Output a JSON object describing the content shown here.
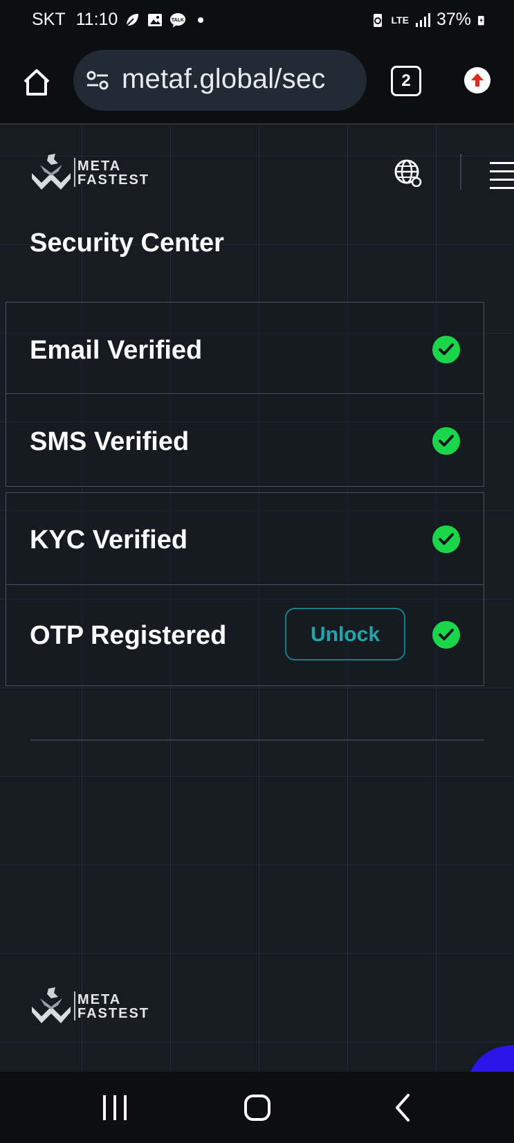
{
  "status_bar": {
    "carrier": "SKT",
    "time": "11:10",
    "network": "LTE",
    "battery": "37%"
  },
  "browser": {
    "url": "metaf.global/sec",
    "tab_count": "2"
  },
  "brand": {
    "line1": "META",
    "line2": "FASTEST"
  },
  "page": {
    "title": "Security Center"
  },
  "security_items": [
    {
      "label": "Email Verified",
      "status": "verified"
    },
    {
      "label": "SMS Verified",
      "status": "verified"
    },
    {
      "label": "KYC Verified",
      "status": "verified"
    },
    {
      "label": "OTP Registered",
      "status": "verified",
      "action": "Unlock"
    }
  ],
  "colors": {
    "check_green": "#19d64a",
    "accent_teal": "#1fa6ad",
    "background": "#171c22"
  }
}
